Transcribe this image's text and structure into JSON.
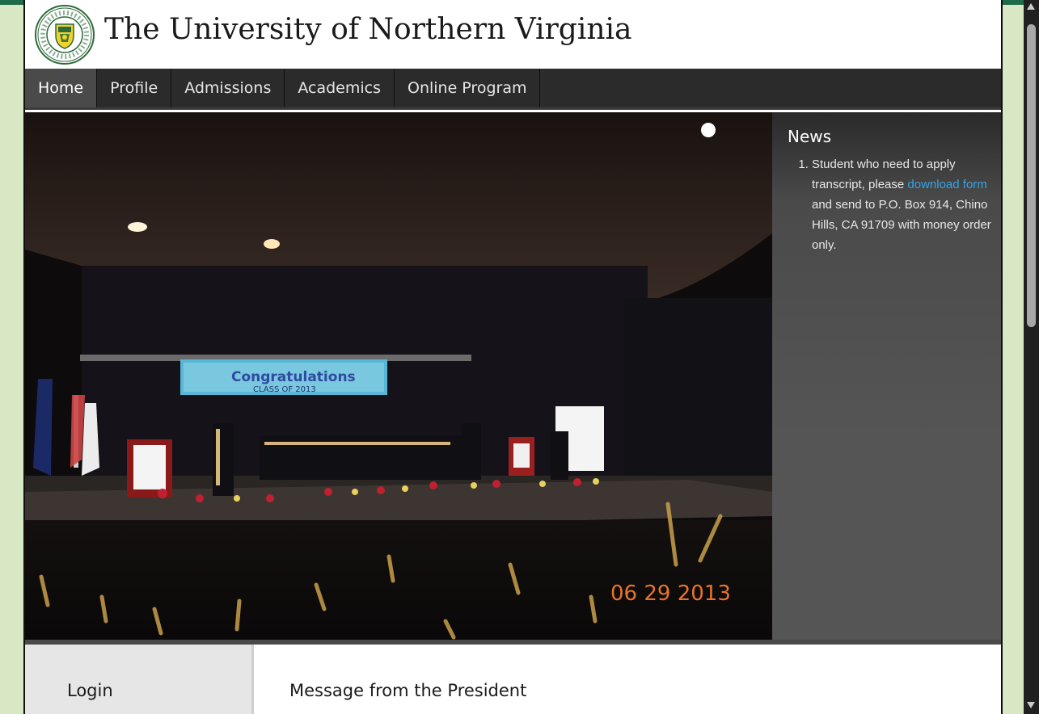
{
  "header": {
    "title": "The University of Northern Virginia",
    "seal_text": "THE UNIVERSITY OF NORTHERN VIRGINIA"
  },
  "nav": {
    "items": [
      {
        "label": "Home",
        "active": true
      },
      {
        "label": "Profile",
        "active": false
      },
      {
        "label": "Admissions",
        "active": false
      },
      {
        "label": "Academics",
        "active": false
      },
      {
        "label": "Online Program",
        "active": false
      }
    ]
  },
  "hero": {
    "banner_text": "Congratulations",
    "banner_subtext": "CLASS OF 2013",
    "date_stamp": "06 29 2013"
  },
  "news": {
    "title": "News",
    "items": [
      {
        "text_before": "Student who need to apply transcript, please ",
        "link_text": "download form",
        "text_after": " and send to P.O. Box 914, Chino Hills, CA 91709 with money order only."
      }
    ]
  },
  "sidebar": {
    "login_title": "Login"
  },
  "main": {
    "message_title": "Message from the President"
  },
  "colors": {
    "brand_green": "#1f6b49",
    "page_bg": "#d8e8c4",
    "nav_bg": "#2b2b2b",
    "link": "#36a4e6"
  }
}
